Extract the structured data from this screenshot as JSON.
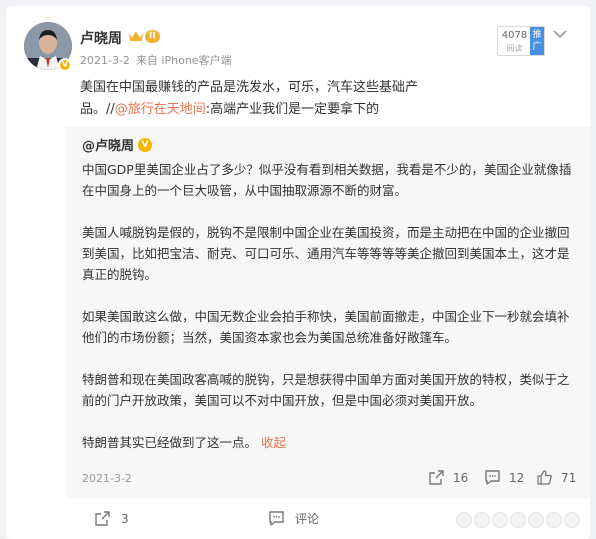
{
  "post": {
    "username": "卢晓周",
    "vip_level": "II",
    "date": "2021-3-2",
    "source": "来自 iPhone客户端",
    "views_count": "4078",
    "views_label": "阅读",
    "promote_label": "推广",
    "text_before_link": "美国在中国最赚钱的产品是洗发水，可乐，汽车这些基础产品。//",
    "link_text": "@旅行在天地间",
    "text_after_link": ":高端产业我们是一定要拿下的"
  },
  "repost": {
    "username": "@卢晓周",
    "paragraphs": [
      "中国GDP里美国企业占了多少？似乎没有看到相关数据，我看是不少的，美国企业就像插在中国身上的一个巨大吸管，从中国抽取源源不断的财富。",
      "美国人喊脱钩是假的，脱钩不是限制中国企业在美国投资，而是主动把在中国的企业撤回到美国，比如把宝洁、耐克、可口可乐、通用汽车等等等等美企撤回到美国本土，这才是真正的脱钩。",
      "如果美国敢这么做，中国无数企业会拍手称快，美国前面撤走，中国企业下一秒就会填补他们的市场份额；当然，美国资本家也会为美国总统准备好敞篷车。",
      "特朗普和现在美国政客高喊的脱钩，只是想获得中国单方面对美国开放的特权，类似于之前的门户开放政策，美国可以不对中国开放，但是中国必须对美国开放。"
    ],
    "last_paragraph": "特朗普其实已经做到了这一点。",
    "collapse_label": "收起",
    "date": "2021-3-2",
    "reposts": "16",
    "comments": "12",
    "likes": "71"
  },
  "actions": {
    "repost_count": "3",
    "comment_label": "评论"
  },
  "colors": {
    "link": "#eb7350",
    "gold": "#f7b500",
    "promote": "#4a90e2"
  }
}
